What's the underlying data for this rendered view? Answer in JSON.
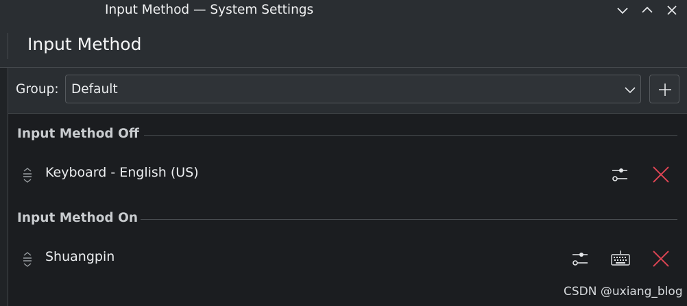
{
  "window": {
    "title": "Input Method — System Settings",
    "controls": [
      "chevron-down-icon",
      "chevron-up-icon",
      "close-icon"
    ]
  },
  "header": {
    "page_title": "Input Method"
  },
  "group": {
    "label": "Group:",
    "selected": "Default",
    "add_icon": "plus-icon"
  },
  "sections": [
    {
      "title": "Input Method Off",
      "items": [
        {
          "label": "Keyboard - English (US)",
          "actions": [
            "configure-icon",
            "remove-icon"
          ]
        }
      ]
    },
    {
      "title": "Input Method On",
      "items": [
        {
          "label": "Shuangpin",
          "actions": [
            "configure-icon",
            "keyboard-icon",
            "remove-icon"
          ]
        }
      ]
    }
  ],
  "colors": {
    "remove": "#da4453",
    "background": "#1b1d20",
    "panel": "#2a2e32"
  },
  "watermark": "CSDN @uxiang_blog"
}
